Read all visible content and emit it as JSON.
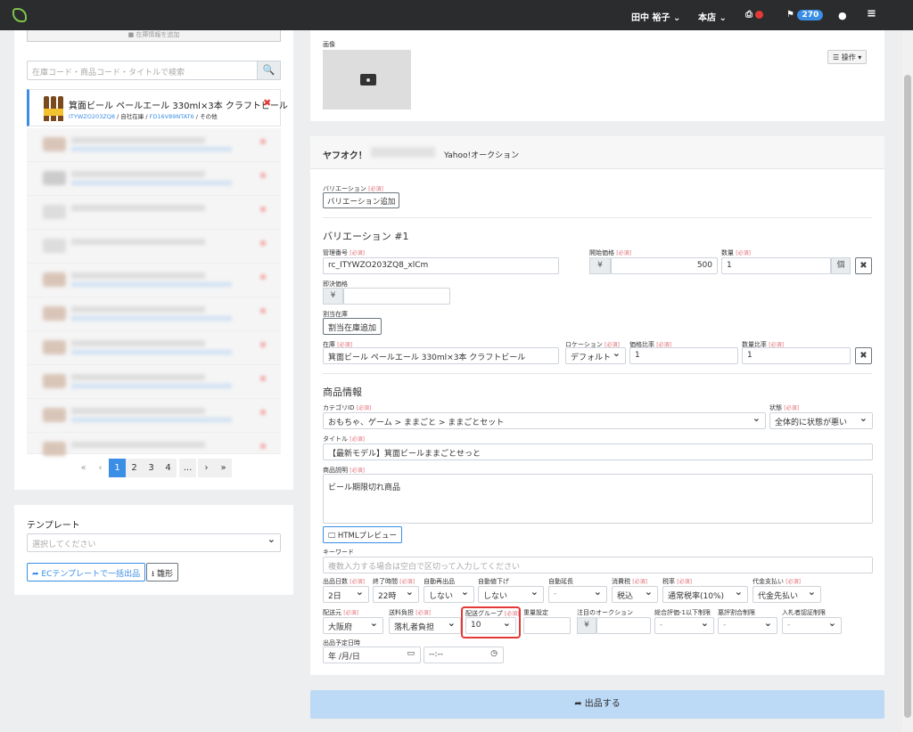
{
  "topbar": {
    "user": "田中 裕子",
    "store": "本店",
    "notifications": "270"
  },
  "left": {
    "top_button": "■ 在庫情報を追加",
    "search_placeholder": "在庫コード・商品コード・タイトルで検索",
    "item": {
      "title": "箕面ビール ペールエール 330ml×3本 クラフトビール",
      "code": "ITYWZO203ZQ8",
      "sep1": " / ",
      "stock": "自社在庫",
      "sep2": " / ",
      "sku": "FD16V89NTAT6",
      "sep3": " / ",
      "other": "その他"
    },
    "pagination": [
      "«",
      "‹",
      "1",
      "2",
      "3",
      "4",
      "...",
      "›",
      "»"
    ],
    "template_title": "テンプレート",
    "template_placeholder": "選択してください",
    "bulk_button": "ECテンプレートで一括出品",
    "template_button": "雛形"
  },
  "right": {
    "image_label": "画像",
    "ops_button": "操作",
    "yahoo_logo": "ヤフオク！",
    "yahoo_name": "Yahoo!オークション",
    "req": "[必須]",
    "variation_label": "バリエーション",
    "variation_add": "バリエーション追加",
    "variation_title": "バリエーション #1",
    "mgmt_label": "管理番号",
    "mgmt_value": "rc_ITYWZO203ZQ8_xlCm",
    "start_price_label": "開始価格",
    "yen": "¥",
    "start_price": "500",
    "qty_label": "数量",
    "qty_value": "1",
    "qty_unit": "個",
    "buynow_label": "即決価格",
    "alloc_label": "割当在庫",
    "alloc_add": "割当在庫追加",
    "stock_label": "在庫",
    "stock_value": "箕面ビール ペールエール 330ml×3本 クラフトビール",
    "location_label": "ロケーション",
    "location_value": "デフォルト",
    "price_ratio_label": "価格比率",
    "price_ratio": "1",
    "qty_ratio_label": "数量比率",
    "qty_ratio": "1",
    "product_info": "商品情報",
    "category_label": "カテゴリID",
    "category_value": "おもちゃ、ゲーム > ままごと > ままごとセット",
    "condition_label": "状態",
    "condition_value": "全体的に状態が悪い",
    "title_label": "タイトル",
    "title_value": "【最新モデル】箕面ビールままごとせっと",
    "desc_label": "商品説明",
    "desc_value": "ビール期限切れ商品",
    "html_preview": "HTMLプレビュー",
    "keyword_label": "キーワード",
    "keyword_placeholder": "複数入力する場合は空白で区切って入力してください",
    "days_label": "出品日数",
    "days_value": "2日",
    "end_time_label": "終了時間",
    "end_time_value": "22時",
    "auto_relist_label": "自動再出品",
    "auto_relist_value": "しない",
    "auto_lower_label": "自動値下げ",
    "auto_lower_value": "しない",
    "auto_extend_label": "自動延長",
    "auto_extend_value": "-",
    "tax_label": "消費税",
    "tax_value": "税込",
    "tax_rate_label": "税率",
    "tax_rate_value": "通常税率(10%)",
    "cod_label": "代金支払い",
    "cod_value": "代金先払い",
    "ship_from_label": "配送元",
    "ship_from_value": "大阪府",
    "ship_pay_label": "送料負担",
    "ship_pay_value": "落札者負担",
    "ship_group_label": "配送グループ",
    "ship_group_value": "10",
    "weight_label": "重量設定",
    "featured_label": "注目のオークション",
    "rating_label": "総合評価-1以下制限",
    "rating_value": "-",
    "bad_rating_label": "悪評割合制限",
    "bad_rating_value": "-",
    "auth_label": "入札者認証制限",
    "auth_value": "-",
    "schedule_label": "出品予定日時",
    "date_value": "年 /月/日",
    "time_value": "--:--",
    "submit": "出品する"
  }
}
